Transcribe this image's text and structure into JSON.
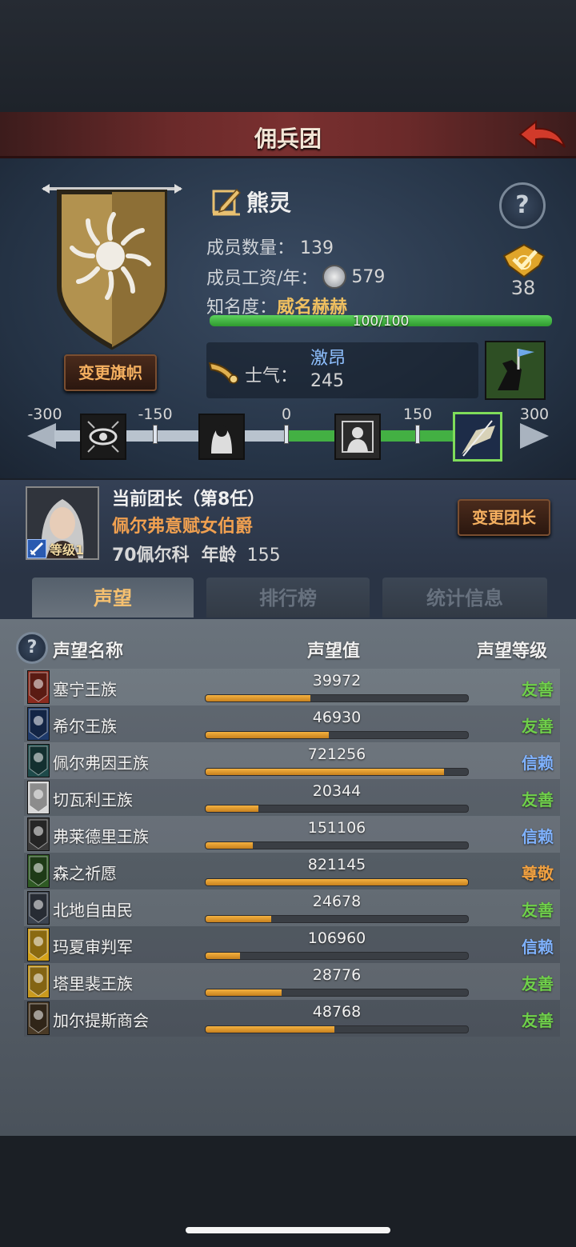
{
  "header": {
    "title": "佣兵团"
  },
  "mercenary": {
    "name": "熊灵",
    "members_label": "成员数量：",
    "members_value": "139",
    "salary_label": "成员工资/年：",
    "salary_value": "579",
    "fame_label": "知名度：",
    "fame_value": "威名赫赫",
    "fame_progress_text": "100/100",
    "fame_progress": 1.0,
    "rank_value": "38",
    "change_banner_label": "变更旗帜"
  },
  "morale": {
    "label": "士气：",
    "state": "激昂",
    "value": "245",
    "scale_ticks": [
      "-300",
      "-150",
      "0",
      "150",
      "300"
    ],
    "scale_value": 245,
    "scale_min": -300,
    "scale_max": 300
  },
  "leader": {
    "title": "当前团长（第8任）",
    "name": "佩尔弗意赋女伯爵",
    "detail_origin": "70佩尔科",
    "age_label": "年龄",
    "age_value": "155",
    "level_label": "等级1",
    "change_leader_label": "变更团长"
  },
  "tabs": [
    {
      "label": "声望",
      "active": true
    },
    {
      "label": "排行榜",
      "active": false
    },
    {
      "label": "统计信息",
      "active": false
    }
  ],
  "list_header": {
    "name": "声望名称",
    "value": "声望值",
    "level": "声望等级"
  },
  "factions": [
    {
      "name": "塞宁王族",
      "value": "39972",
      "progress": 0.4,
      "level": "友善",
      "level_color": "#6fd04a",
      "icon_color": "#8a2a1e"
    },
    {
      "name": "希尔王族",
      "value": "46930",
      "progress": 0.47,
      "level": "友善",
      "level_color": "#6fd04a",
      "icon_color": "#1e3a6a"
    },
    {
      "name": "佩尔弗因王族",
      "value": "721256",
      "progress": 0.91,
      "level": "信赖",
      "level_color": "#7fb2ff",
      "icon_color": "#1e4a4a"
    },
    {
      "name": "切瓦利王族",
      "value": "20344",
      "progress": 0.2,
      "level": "友善",
      "level_color": "#6fd04a",
      "icon_color": "#d8d8d8"
    },
    {
      "name": "弗莱德里王族",
      "value": "151106",
      "progress": 0.18,
      "level": "信赖",
      "level_color": "#7fb2ff",
      "icon_color": "#3a3a3a"
    },
    {
      "name": "森之祈愿",
      "value": "821145",
      "progress": 1.0,
      "level": "尊敬",
      "level_color": "#f0a040",
      "icon_color": "#2f5a24"
    },
    {
      "name": "北地自由民",
      "value": "24678",
      "progress": 0.25,
      "level": "友善",
      "level_color": "#6fd04a",
      "icon_color": "#3c4450"
    },
    {
      "name": "玛夏审判军",
      "value": "106960",
      "progress": 0.13,
      "level": "信赖",
      "level_color": "#7fb2ff",
      "icon_color": "#d4a21a"
    },
    {
      "name": "塔里裴王族",
      "value": "28776",
      "progress": 0.29,
      "level": "友善",
      "level_color": "#6fd04a",
      "icon_color": "#c99a1e"
    },
    {
      "name": "加尔提斯商会",
      "value": "48768",
      "progress": 0.49,
      "level": "友善",
      "level_color": "#6fd04a",
      "icon_color": "#4a3a26"
    }
  ],
  "colors": {
    "accent_orange": "#f5b060",
    "fame_green": "#4bc24b",
    "morale_green": "#43b043"
  }
}
